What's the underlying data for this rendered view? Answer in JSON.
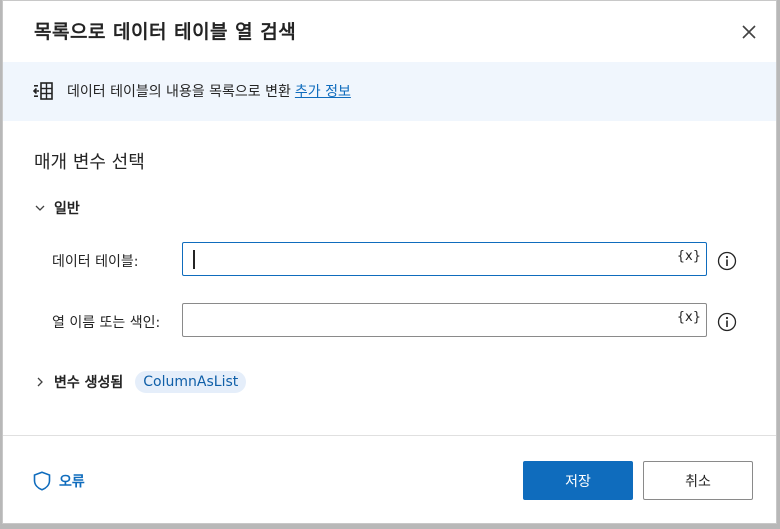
{
  "dialog": {
    "title": "목록으로 데이터 테이블 열 검색",
    "close_icon": "close-icon"
  },
  "info": {
    "icon": "table-to-list-icon",
    "text": "데이터 테이블의 내용을 목록으로 변환",
    "link": "추가 정보"
  },
  "params": {
    "section_title": "매개 변수 선택",
    "group_label": "일반",
    "fields": [
      {
        "label": "데이터 테이블:",
        "value": "",
        "var_button": "{x}"
      },
      {
        "label": "열 이름 또는 색인:",
        "value": "",
        "var_button": "{x}"
      }
    ]
  },
  "variables": {
    "label": "변수 생성됨",
    "chips": [
      "ColumnAsList"
    ]
  },
  "footer": {
    "error_label": "오류",
    "save_label": "저장",
    "cancel_label": "취소"
  },
  "colors": {
    "accent": "#0f6cbd",
    "info_bar_bg": "#f0f6fd",
    "chip_bg": "#e5eefa"
  }
}
